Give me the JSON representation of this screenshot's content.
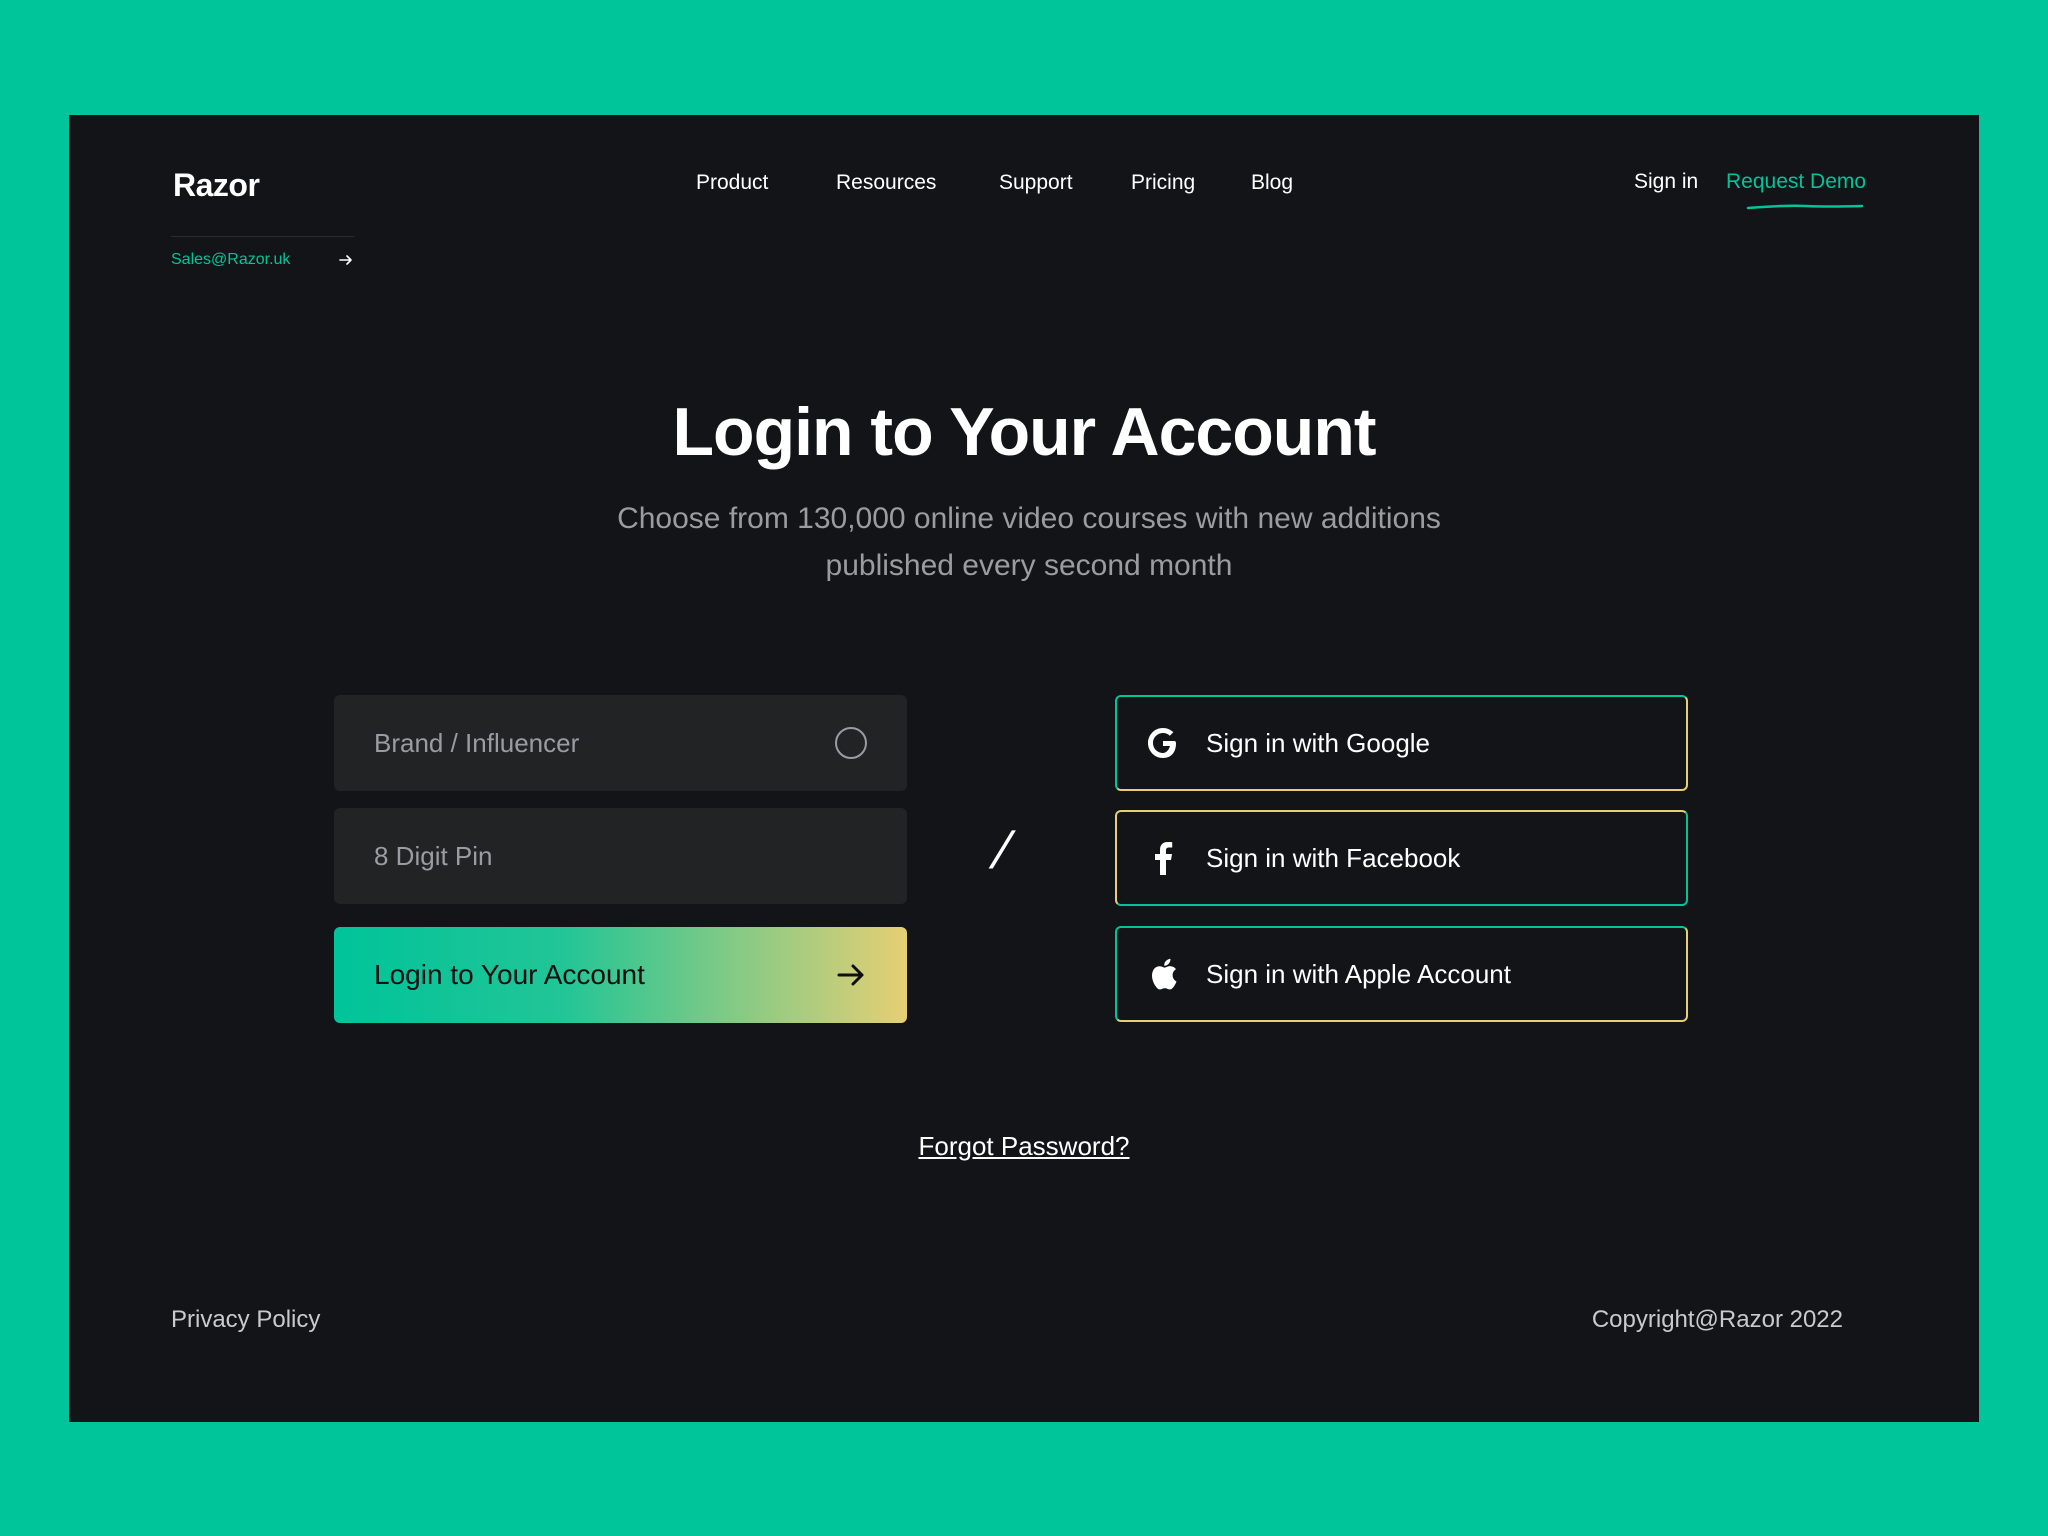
{
  "brand": {
    "name": "Razor",
    "sales_email": "Sales@Razor.uk"
  },
  "nav": {
    "items": [
      "Product",
      "Resources",
      "Support",
      "Pricing",
      "Blog"
    ],
    "sign_in": "Sign in",
    "request_demo": "Request Demo"
  },
  "hero": {
    "title": "Login to Your Account",
    "subtitle": "Choose from 130,000 online video courses with new additions published every second month"
  },
  "form": {
    "account_type_placeholder": "Brand / Influencer",
    "pin_placeholder": "8 Digit Pin",
    "submit_label": "Login to Your Account"
  },
  "divider": "/",
  "social": {
    "google": "Sign in with Google",
    "facebook": "Sign in with Facebook",
    "apple": "Sign in with Apple Account"
  },
  "forgot_password": "Forgot Password?",
  "footer": {
    "privacy": "Privacy Policy",
    "copyright": "Copyright@Razor 2022"
  },
  "colors": {
    "accent": "#00c49a",
    "gold": "#e6cf74",
    "background": "#131418",
    "field": "#222325"
  }
}
